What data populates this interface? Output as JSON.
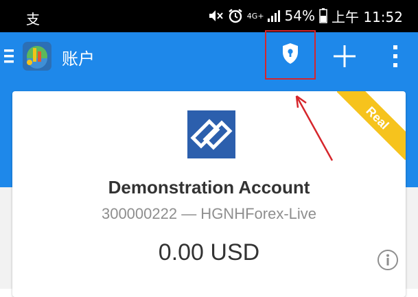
{
  "status_bar": {
    "left_glyph": "支",
    "network": "4G+",
    "battery": "54%",
    "time": "上午 11:52",
    "icons": [
      "mute-icon",
      "alarm-icon",
      "signal-icon",
      "battery-icon"
    ]
  },
  "app_bar": {
    "title": "账户",
    "background": "#1e88ea",
    "icons": [
      "hamburger-menu-icon",
      "metatrader-logo",
      "shield-lock-icon",
      "plus-icon",
      "overflow-menu-icon"
    ],
    "highlight_color": "#d6262c"
  },
  "account": {
    "badge": "Real",
    "badge_color": "#f6c31d",
    "name": "Demonstration Account",
    "number_server": "300000222 — HGNHForex-Live",
    "balance": "0.00 USD",
    "logo_color": "#2c5fad"
  }
}
